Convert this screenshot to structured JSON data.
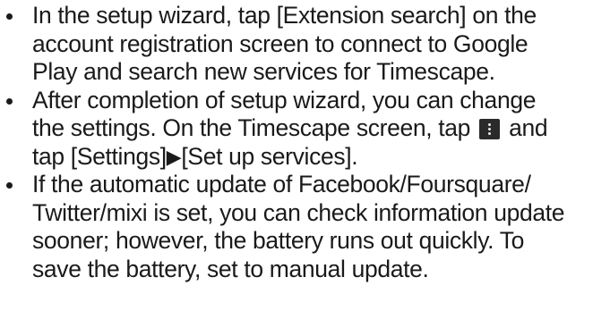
{
  "bullets": [
    {
      "lines": [
        "In the setup wizard, tap [Extension search] on the",
        "account registration screen to connect to Google",
        "Play and search new services for Timescape."
      ]
    },
    {
      "lines": [
        "After completion of setup wizard, you can change",
        "the settings. On the Timescape screen, tap",
        "and",
        "tap [Settings]",
        "[Set up services]."
      ],
      "icon": "menu-dots-icon",
      "arrow": "▶"
    },
    {
      "lines": [
        "If the automatic update of Facebook/Foursquare/",
        "Twitter/mixi is set, you can check information update",
        "sooner; however, the battery runs out quickly. To",
        "save the battery, set to manual update."
      ]
    }
  ]
}
